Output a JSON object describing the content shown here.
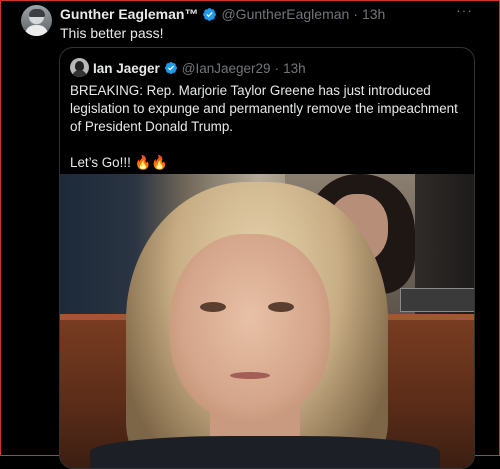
{
  "tweet": {
    "author_name": "Gunther Eagleman™",
    "author_handle": "@GuntherEagleman",
    "separator": "·",
    "time": "13h",
    "more": "···",
    "text": "This better pass!"
  },
  "quoted_tweet": {
    "author_name": "Ian Jaeger",
    "author_handle": "@IanJaeger29",
    "separator": "·",
    "time": "13h",
    "text_line1": "BREAKING: Rep. Marjorie Taylor Greene has just introduced legislation to expunge and permanently remove the impeachment of President Donald Trump.",
    "text_line2": "Let’s Go!!! 🔥🔥"
  },
  "colors": {
    "background": "#000000",
    "verified_badge": "#1d9bf0",
    "secondary_text": "#71767b",
    "frame_border": "#d0342c"
  }
}
